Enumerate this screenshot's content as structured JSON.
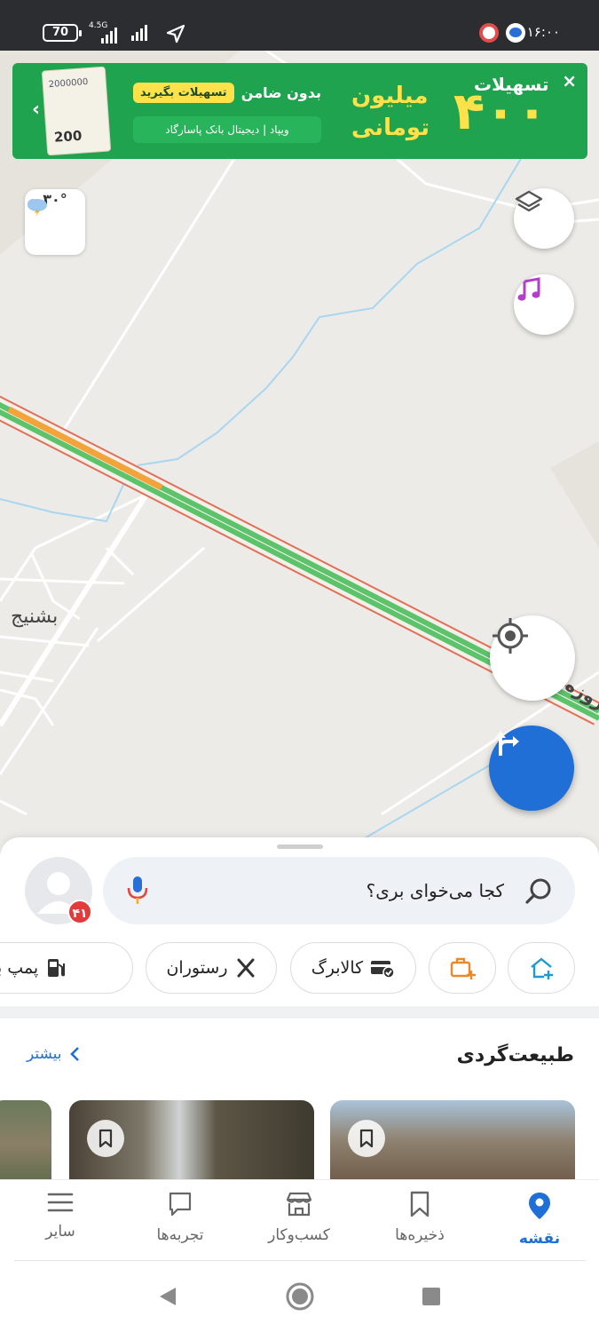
{
  "status_bar": {
    "battery": "70",
    "network": "4.5G",
    "time": "۱۶:۰۰"
  },
  "ad": {
    "amount": "۴۰۰",
    "headline": "تسهیلات",
    "unit_line1": "میلیون",
    "unit_line2": "تومانی",
    "guarantor_text": "بدون ضامن",
    "cta": "تسهیلات بگیرید",
    "bank_line": "ویپاد | دیجیتال بانک پاسارگاد",
    "money_note": "200",
    "money_top": "2000000"
  },
  "weather": {
    "temperature": "۳۰°",
    "icon": "cloud-lightning-icon"
  },
  "map": {
    "town_label": "بشنیج",
    "road_label": "روزه",
    "colors": {
      "traffic_green": "#5cc36a",
      "traffic_orange": "#f2a33a",
      "road_border": "#e0705a",
      "water": "#a9d6f0"
    }
  },
  "search": {
    "placeholder": "کجا می‌خوای بری؟"
  },
  "avatar": {
    "badge_count": "۴۱"
  },
  "chips": [
    {
      "label": "",
      "icon": "home-add-icon"
    },
    {
      "label": "",
      "icon": "work-add-icon"
    },
    {
      "label": "کالابرگ",
      "icon": "card-check-icon"
    },
    {
      "label": "رستوران",
      "icon": "fork-knife-icon"
    },
    {
      "label": "پمپ بنزین",
      "icon": "fuel-pump-icon"
    }
  ],
  "section": {
    "title": "طبیعت‌گردی",
    "more": "بیشتر"
  },
  "bottom_nav": {
    "items": [
      {
        "label": "نقشه",
        "icon": "map-pin-icon",
        "active": true
      },
      {
        "label": "ذخیره‌ها",
        "icon": "bookmark-icon",
        "active": false
      },
      {
        "label": "کسب‌وکار",
        "icon": "store-icon",
        "active": false
      },
      {
        "label": "تجربه‌ها",
        "icon": "chat-icon",
        "active": false
      },
      {
        "label": "سایر",
        "icon": "menu-icon",
        "active": false
      }
    ]
  },
  "colors": {
    "accent": "#1f6fd6",
    "ad_green": "#1fa34f",
    "ad_yellow": "#ffe14a",
    "badge_red": "#e23b3b"
  }
}
